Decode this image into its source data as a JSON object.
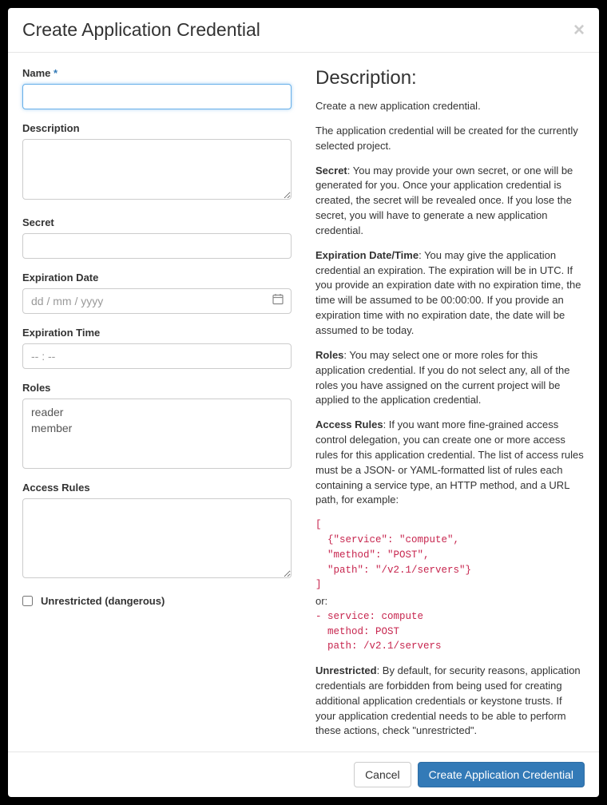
{
  "header": {
    "title": "Create Application Credential"
  },
  "form": {
    "name_label": "Name",
    "required_mark": "*",
    "description_label": "Description",
    "secret_label": "Secret",
    "expiration_date_label": "Expiration Date",
    "expiration_date_placeholder": "dd / mm / yyyy",
    "expiration_time_label": "Expiration Time",
    "expiration_time_placeholder": "-- : --",
    "roles_label": "Roles",
    "roles_options": [
      "reader",
      "member"
    ],
    "access_rules_label": "Access Rules",
    "unrestricted_label": "Unrestricted (dangerous)"
  },
  "help": {
    "heading": "Description:",
    "intro": "Create a new application credential.",
    "project_note": "The application credential will be created for the currently selected project.",
    "secret_bold": "Secret",
    "secret_text": ": You may provide your own secret, or one will be generated for you. Once your application credential is created, the secret will be revealed once. If you lose the secret, you will have to generate a new application credential.",
    "exp_bold": "Expiration Date/Time",
    "exp_text": ": You may give the application credential an expiration. The expiration will be in UTC. If you provide an expiration date with no expiration time, the time will be assumed to be 00:00:00. If you provide an expiration time with no expiration date, the date will be assumed to be today.",
    "roles_bold": "Roles",
    "roles_text": ": You may select one or more roles for this application credential. If you do not select any, all of the roles you have assigned on the current project will be applied to the application credential.",
    "ar_bold": "Access Rules",
    "ar_text": ": If you want more fine-grained access control delegation, you can create one or more access rules for this application credential. The list of access rules must be a JSON- or YAML-formatted list of rules each containing a service type, an HTTP method, and a URL path, for example:",
    "code_json": "[\n  {\"service\": \"compute\",\n  \"method\": \"POST\",\n  \"path\": \"/v2.1/servers\"}\n]",
    "or": "or:",
    "code_yaml": "- service: compute\n  method: POST\n  path: /v2.1/servers",
    "unres_bold": "Unrestricted",
    "unres_text": ": By default, for security reasons, application credentials are forbidden from being used for creating additional application credentials or keystone trusts. If your application credential needs to be able to perform these actions, check \"unrestricted\"."
  },
  "footer": {
    "cancel": "Cancel",
    "submit": "Create Application Credential"
  }
}
